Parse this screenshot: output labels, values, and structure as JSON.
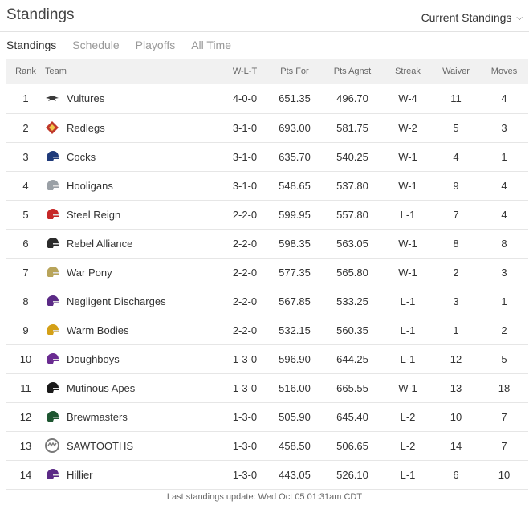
{
  "header": {
    "title": "Standings",
    "dropdown_label": "Current Standings"
  },
  "tabs": [
    {
      "label": "Standings"
    },
    {
      "label": "Schedule"
    },
    {
      "label": "Playoffs"
    },
    {
      "label": "All Time"
    }
  ],
  "columns": {
    "rank": "Rank",
    "team": "Team",
    "wlt": "W-L-T",
    "pts_for": "Pts For",
    "pts_agnst": "Pts Agnst",
    "streak": "Streak",
    "waiver": "Waiver",
    "moves": "Moves"
  },
  "rows": [
    {
      "rank": "1",
      "team": "Vultures",
      "wlt": "4-0-0",
      "pts_for": "651.35",
      "pts_agnst": "496.70",
      "streak": "W-4",
      "waiver": "11",
      "moves": "4",
      "logo_icon": "vulture-logo-icon",
      "logo_color": "#3a3a3a"
    },
    {
      "rank": "2",
      "team": "Redlegs",
      "wlt": "3-1-0",
      "pts_for": "693.00",
      "pts_agnst": "581.75",
      "streak": "W-2",
      "waiver": "5",
      "moves": "3",
      "logo_icon": "redlegs-logo-icon",
      "logo_color": "#c0392b"
    },
    {
      "rank": "3",
      "team": "Cocks",
      "wlt": "3-1-0",
      "pts_for": "635.70",
      "pts_agnst": "540.25",
      "streak": "W-1",
      "waiver": "4",
      "moves": "1",
      "logo_icon": "helmet-logo-icon",
      "logo_color": "#1f3a7a"
    },
    {
      "rank": "4",
      "team": "Hooligans",
      "wlt": "3-1-0",
      "pts_for": "548.65",
      "pts_agnst": "537.80",
      "streak": "W-1",
      "waiver": "9",
      "moves": "4",
      "logo_icon": "helmet-logo-icon",
      "logo_color": "#9aa0a6"
    },
    {
      "rank": "5",
      "team": "Steel Reign",
      "wlt": "2-2-0",
      "pts_for": "599.95",
      "pts_agnst": "557.80",
      "streak": "L-1",
      "waiver": "7",
      "moves": "4",
      "logo_icon": "helmet-logo-icon",
      "logo_color": "#c62828"
    },
    {
      "rank": "6",
      "team": "Rebel Alliance",
      "wlt": "2-2-0",
      "pts_for": "598.35",
      "pts_agnst": "563.05",
      "streak": "W-1",
      "waiver": "8",
      "moves": "8",
      "logo_icon": "helmet-logo-icon",
      "logo_color": "#2b2b2b"
    },
    {
      "rank": "7",
      "team": "War Pony",
      "wlt": "2-2-0",
      "pts_for": "577.35",
      "pts_agnst": "565.80",
      "streak": "W-1",
      "waiver": "2",
      "moves": "3",
      "logo_icon": "helmet-logo-icon",
      "logo_color": "#b8a45a"
    },
    {
      "rank": "8",
      "team": "Negligent Discharges",
      "wlt": "2-2-0",
      "pts_for": "567.85",
      "pts_agnst": "533.25",
      "streak": "L-1",
      "waiver": "3",
      "moves": "1",
      "logo_icon": "helmet-logo-icon",
      "logo_color": "#5b2a86"
    },
    {
      "rank": "9",
      "team": "Warm Bodies",
      "wlt": "2-2-0",
      "pts_for": "532.15",
      "pts_agnst": "560.35",
      "streak": "L-1",
      "waiver": "1",
      "moves": "2",
      "logo_icon": "helmet-logo-icon",
      "logo_color": "#d4a017"
    },
    {
      "rank": "10",
      "team": "Doughboys",
      "wlt": "1-3-0",
      "pts_for": "596.90",
      "pts_agnst": "644.25",
      "streak": "L-1",
      "waiver": "12",
      "moves": "5",
      "logo_icon": "helmet-logo-icon",
      "logo_color": "#6a2c91"
    },
    {
      "rank": "11",
      "team": "Mutinous Apes",
      "wlt": "1-3-0",
      "pts_for": "516.00",
      "pts_agnst": "665.55",
      "streak": "W-1",
      "waiver": "13",
      "moves": "18",
      "logo_icon": "helmet-logo-icon",
      "logo_color": "#1a1a1a"
    },
    {
      "rank": "12",
      "team": "Brewmasters",
      "wlt": "1-3-0",
      "pts_for": "505.90",
      "pts_agnst": "645.40",
      "streak": "L-2",
      "waiver": "10",
      "moves": "7",
      "logo_icon": "helmet-logo-icon",
      "logo_color": "#1e5631"
    },
    {
      "rank": "13",
      "team": "SAWTOOTHS",
      "wlt": "1-3-0",
      "pts_for": "458.50",
      "pts_agnst": "506.65",
      "streak": "L-2",
      "waiver": "14",
      "moves": "7",
      "logo_icon": "sawtooth-logo-icon",
      "logo_color": "#7a7a7a"
    },
    {
      "rank": "14",
      "team": "Hillier",
      "wlt": "1-3-0",
      "pts_for": "443.05",
      "pts_agnst": "526.10",
      "streak": "L-1",
      "waiver": "6",
      "moves": "10",
      "logo_icon": "helmet-logo-icon",
      "logo_color": "#5b2a86"
    }
  ],
  "footer": {
    "text": "Last standings update: Wed Oct 05 01:31am CDT"
  }
}
